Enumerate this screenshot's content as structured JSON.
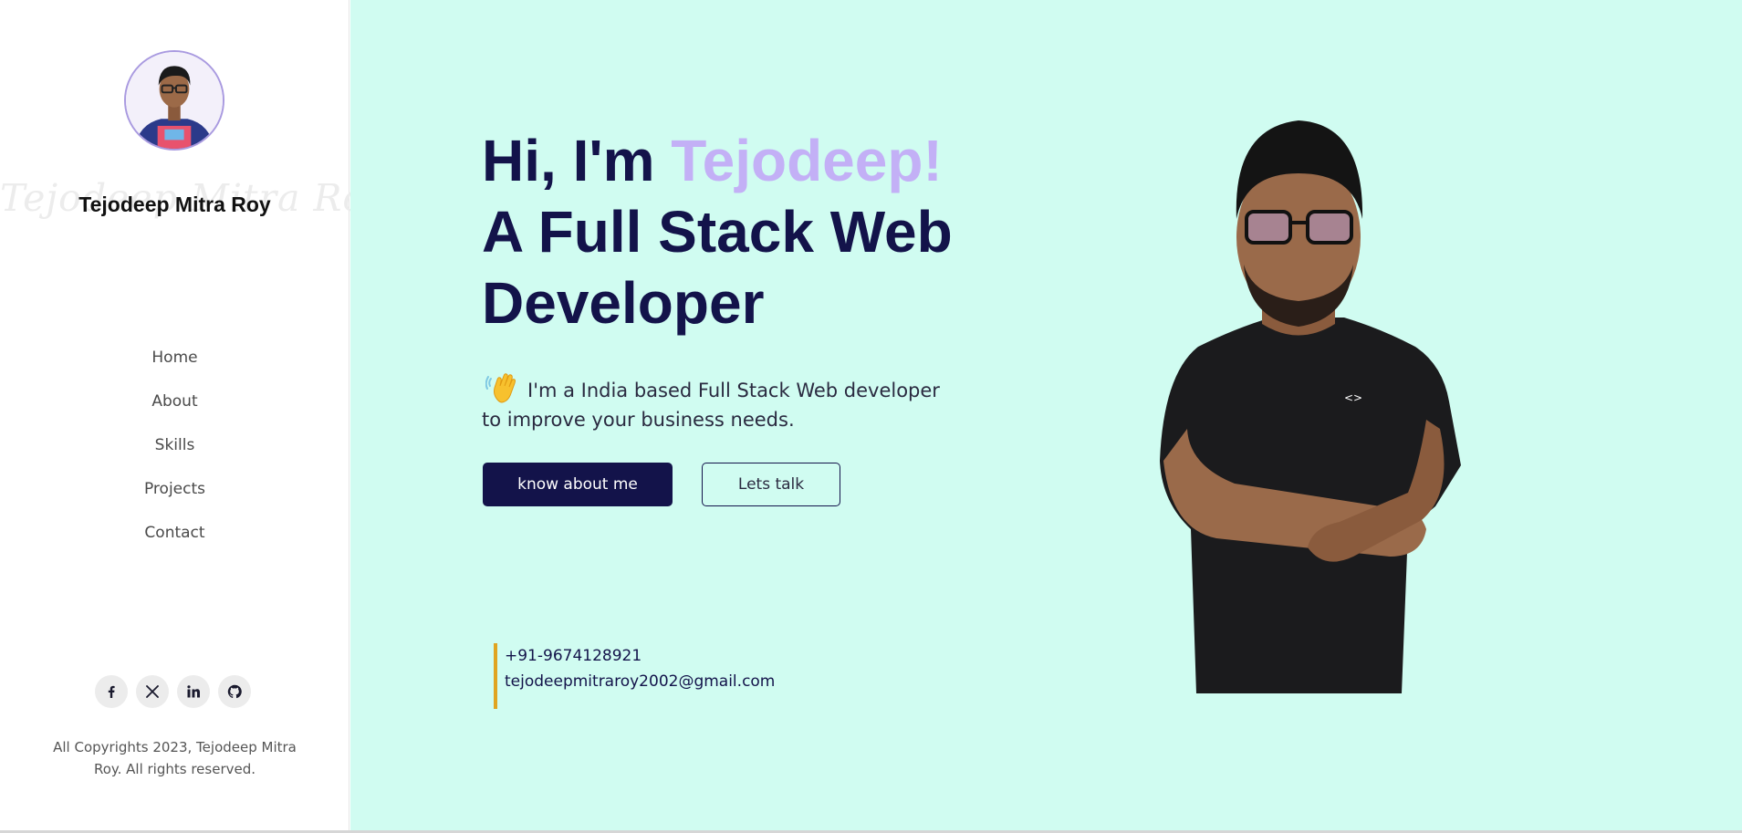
{
  "sidebar": {
    "name_watermark": "Tejodeep Mitra Roy",
    "name": "Tejodeep Mitra Roy",
    "nav": [
      "Home",
      "About",
      "Skills",
      "Projects",
      "Contact"
    ],
    "socials": [
      "facebook-icon",
      "x-icon",
      "linkedin-icon",
      "github-icon"
    ],
    "copyright": "All Copyrights 2023, Tejodeep Mitra Roy. All rights reserved."
  },
  "hero": {
    "greeting": "Hi, I'm ",
    "highlight_name": "Tejodeep!",
    "role": "A Full Stack Web Developer",
    "intro": "I'm a India based Full Stack Web developer to improve your business needs.",
    "primary_button": "know about me",
    "secondary_button": "Lets talk",
    "phone": "+91-9674128921",
    "email": "tejodeepmitraroy2002@gmail.com"
  },
  "colors": {
    "main_bg": "#d0fcf1",
    "navy": "#13134a",
    "accent_purple": "#c3b0f6",
    "contact_bar": "#e0a420"
  }
}
